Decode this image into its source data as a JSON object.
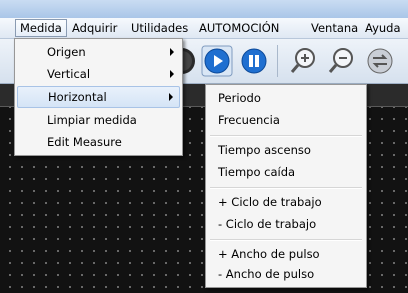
{
  "menubar": {
    "items": [
      {
        "label": "Medida",
        "active": true
      },
      {
        "label": "Adquirir"
      },
      {
        "label": "Utilidades"
      },
      {
        "label": "AUTOMOCIÓN"
      },
      {
        "label": "Ventana"
      },
      {
        "label": "Ayuda"
      }
    ]
  },
  "medida_menu": {
    "items": [
      {
        "label": "Origen",
        "submenu": true
      },
      {
        "label": "Vertical",
        "submenu": true
      },
      {
        "label": "Horizontal",
        "submenu": true,
        "highlighted": true
      },
      {
        "label": "Limpiar medida"
      },
      {
        "label": "Edit Measure"
      }
    ]
  },
  "horizontal_submenu": {
    "items": [
      {
        "label": "Periodo"
      },
      {
        "label": "Frecuencia"
      },
      {
        "label": "Tiempo ascenso"
      },
      {
        "label": "Tiempo caída"
      },
      {
        "label": "+ Ciclo de trabajo"
      },
      {
        "label": "- Ciclo de trabajo"
      },
      {
        "label": "+ Ancho de pulso"
      },
      {
        "label": "- Ancho de pulso"
      }
    ]
  },
  "toolbar": {
    "buttons": [
      {
        "icon": "run-icon"
      },
      {
        "icon": "play-icon"
      },
      {
        "icon": "pause-icon"
      },
      {
        "icon": "zoom-in-icon"
      },
      {
        "icon": "zoom-out-icon"
      },
      {
        "icon": "autoset-icon"
      }
    ]
  },
  "colors": {
    "accent_blue": "#1f6fd0",
    "menu_highlight": "#d5e4f6",
    "plot_background": "#121212"
  }
}
